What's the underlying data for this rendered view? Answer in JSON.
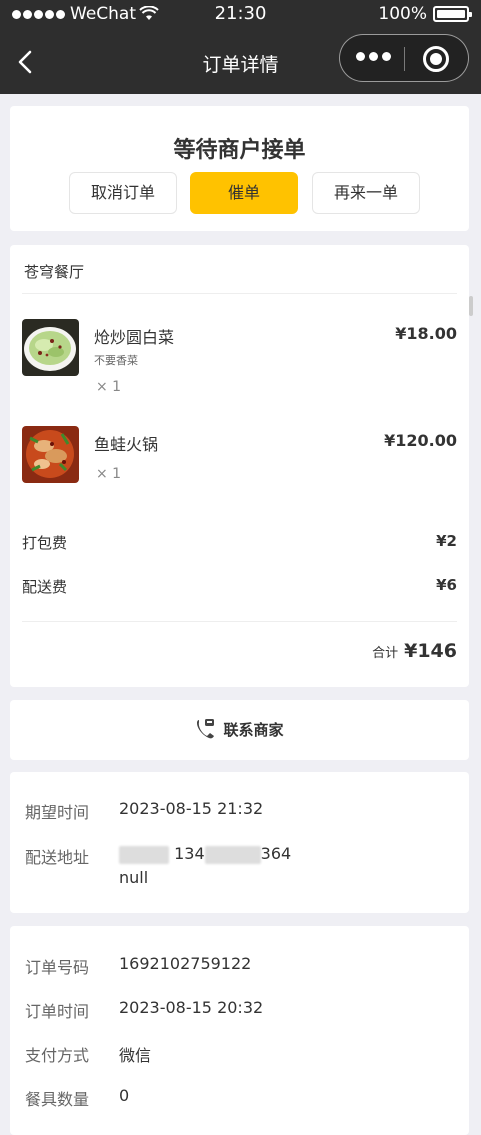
{
  "statusbar": {
    "carrier": "WeChat",
    "time": "21:30",
    "battery": "100%"
  },
  "navbar": {
    "title": "订单详情"
  },
  "status": {
    "title": "等待商户接单",
    "cancel_label": "取消订单",
    "urge_label": "催单",
    "again_label": "再来一单"
  },
  "order": {
    "shop": "苍穹餐厅",
    "dishes": [
      {
        "name": "炝炒圆白菜",
        "note": "不要香菜",
        "qty": "× 1",
        "price": "¥18.00"
      },
      {
        "name": "鱼蛙火锅",
        "qty": "× 1",
        "price": "¥120.00"
      }
    ],
    "packing_label": "打包费",
    "packing_value": "¥2",
    "delivery_label": "配送费",
    "delivery_value": "¥6",
    "total_label": "合计",
    "total_value": "¥146"
  },
  "contact": {
    "label": "联系商家"
  },
  "delivery": {
    "expected_label": "期望时间",
    "expected_value": "2023-08-15 21:32",
    "address_label": "配送地址",
    "address_phone_start": "134",
    "address_phone_end": "364",
    "address_line2": "null"
  },
  "info": {
    "order_no_label": "订单号码",
    "order_no_value": "1692102759122",
    "order_time_label": "订单时间",
    "order_time_value": "2023-08-15 20:32",
    "pay_label": "支付方式",
    "pay_value": "微信",
    "tableware_label": "餐具数量",
    "tableware_value": "0"
  },
  "colors": {
    "accent": "#ffc200",
    "nav": "#2e2e2e",
    "bg": "#efeff4"
  }
}
